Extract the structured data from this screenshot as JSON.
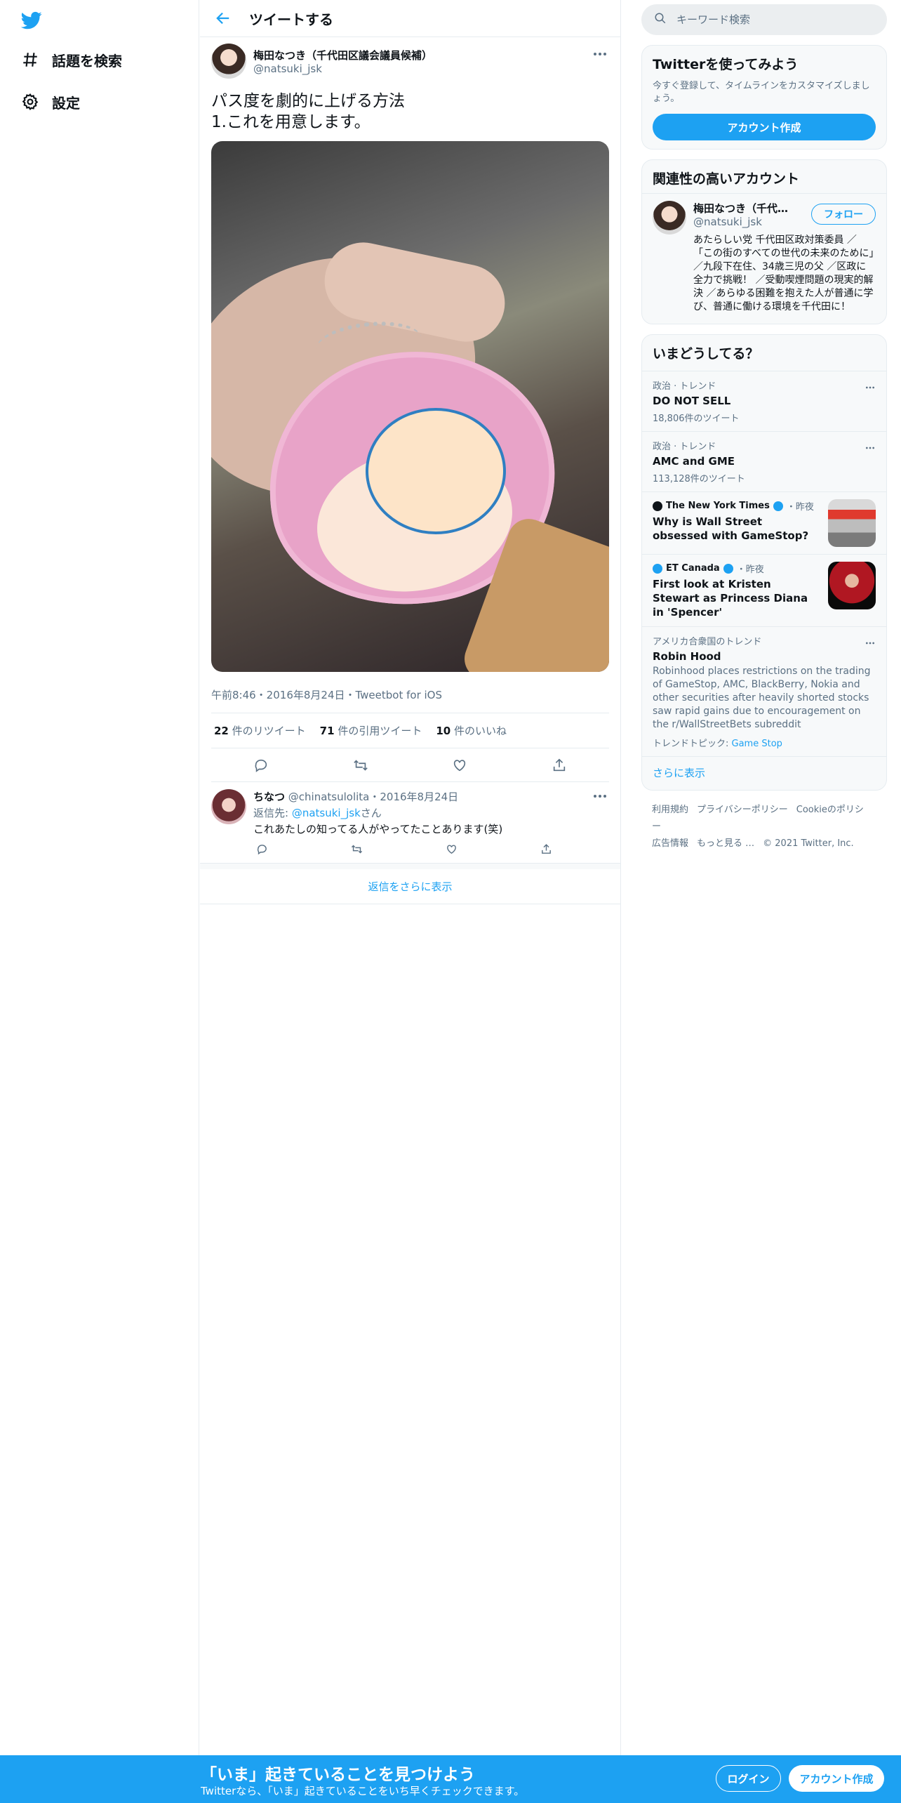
{
  "nav": {
    "explore_label": "話題を検索",
    "settings_label": "設定"
  },
  "main": {
    "title": "ツイートする",
    "tweet": {
      "author_name": "梅田なつき（千代田区議会議員候補）",
      "author_handle": "@natsuki_jsk",
      "text": "パス度を劇的に上げる方法\n1.これを用意します。",
      "meta": "午前8:46・2016年8月24日・Tweetbot for iOS",
      "retweets_count": "22",
      "retweets_label": "件のリツイート",
      "quotes_count": "71",
      "quotes_label": "件の引用ツイート",
      "likes_count": "10",
      "likes_label": "件のいいね"
    },
    "reply": {
      "name": "ちなつ",
      "handle": "@chinatsulolita",
      "date": "・2016年8月24日",
      "reply_to_prefix": "返信先: ",
      "reply_to_handle": "@natsuki_jsk",
      "reply_to_suffix": "さん",
      "text": "これあたしの知ってる人がやってたことあります(笑)"
    },
    "show_more_replies": "返信をさらに表示"
  },
  "right": {
    "search_placeholder": "キーワード検索",
    "signup_card": {
      "title": "Twitterを使ってみよう",
      "subtitle": "今すぐ登録して、タイムラインをカスタマイズしましょう。",
      "button": "アカウント作成"
    },
    "related_card": {
      "title": "関連性の高いアカウント",
      "name": "梅田なつき（千代田区議会議員候補）",
      "handle": "@natsuki_jsk",
      "follow": "フォロー",
      "bio": "あたらしい党 千代田区政対策委員 ／「この街のすべての世代の未来のために」／九段下在住、34歳三児の父 ／区政に全力で挑戦！ ／受動喫煙問題の現実的解決 ／あらゆる困難を抱えた人が普通に学び、普通に働ける環境を千代田に！"
    },
    "trends_card": {
      "title": "いまどうしてる？",
      "trends": [
        {
          "context": "政治 · トレンド",
          "title": "DO NOT SELL",
          "count": "18,806件のツイート"
        },
        {
          "context": "政治 · トレンド",
          "title": "AMC and GME",
          "count": "113,128件のツイート"
        }
      ],
      "news": [
        {
          "source": "The New York Times",
          "time": "・昨夜",
          "title": "Why is Wall Street obsessed with GameStop?"
        },
        {
          "source": "ET Canada",
          "time": "・昨夜",
          "title": "First look at Kristen Stewart as Princess Diana in 'Spencer'"
        }
      ],
      "robin": {
        "context": "アメリカ合衆国のトレンド",
        "title": "Robin Hood",
        "desc": "Robinhood places restrictions on the trading of GameStop, AMC, BlackBerry, Nokia and other securities after heavily shorted stocks saw rapid gains due to encouragement on the r/WallStreetBets subreddit",
        "topic_label": "トレンドトピック: ",
        "topic": "Game Stop"
      },
      "more": "さらに表示"
    },
    "footer": {
      "terms": "利用規約",
      "privacy": "プライバシーポリシー",
      "cookie": "Cookieのポリシー",
      "ads": "広告情報",
      "more": "もっと見る …",
      "copyright": "© 2021 Twitter, Inc."
    }
  },
  "bottom": {
    "title": "「いま」起きていることを見つけよう",
    "subtitle": "Twitterなら、「いま」起きていることをいち早くチェックできます。",
    "login": "ログイン",
    "signup": "アカウント作成"
  },
  "colors": {
    "brand": "#1da1f2",
    "text": "#0f1419",
    "muted": "#5b7083"
  }
}
